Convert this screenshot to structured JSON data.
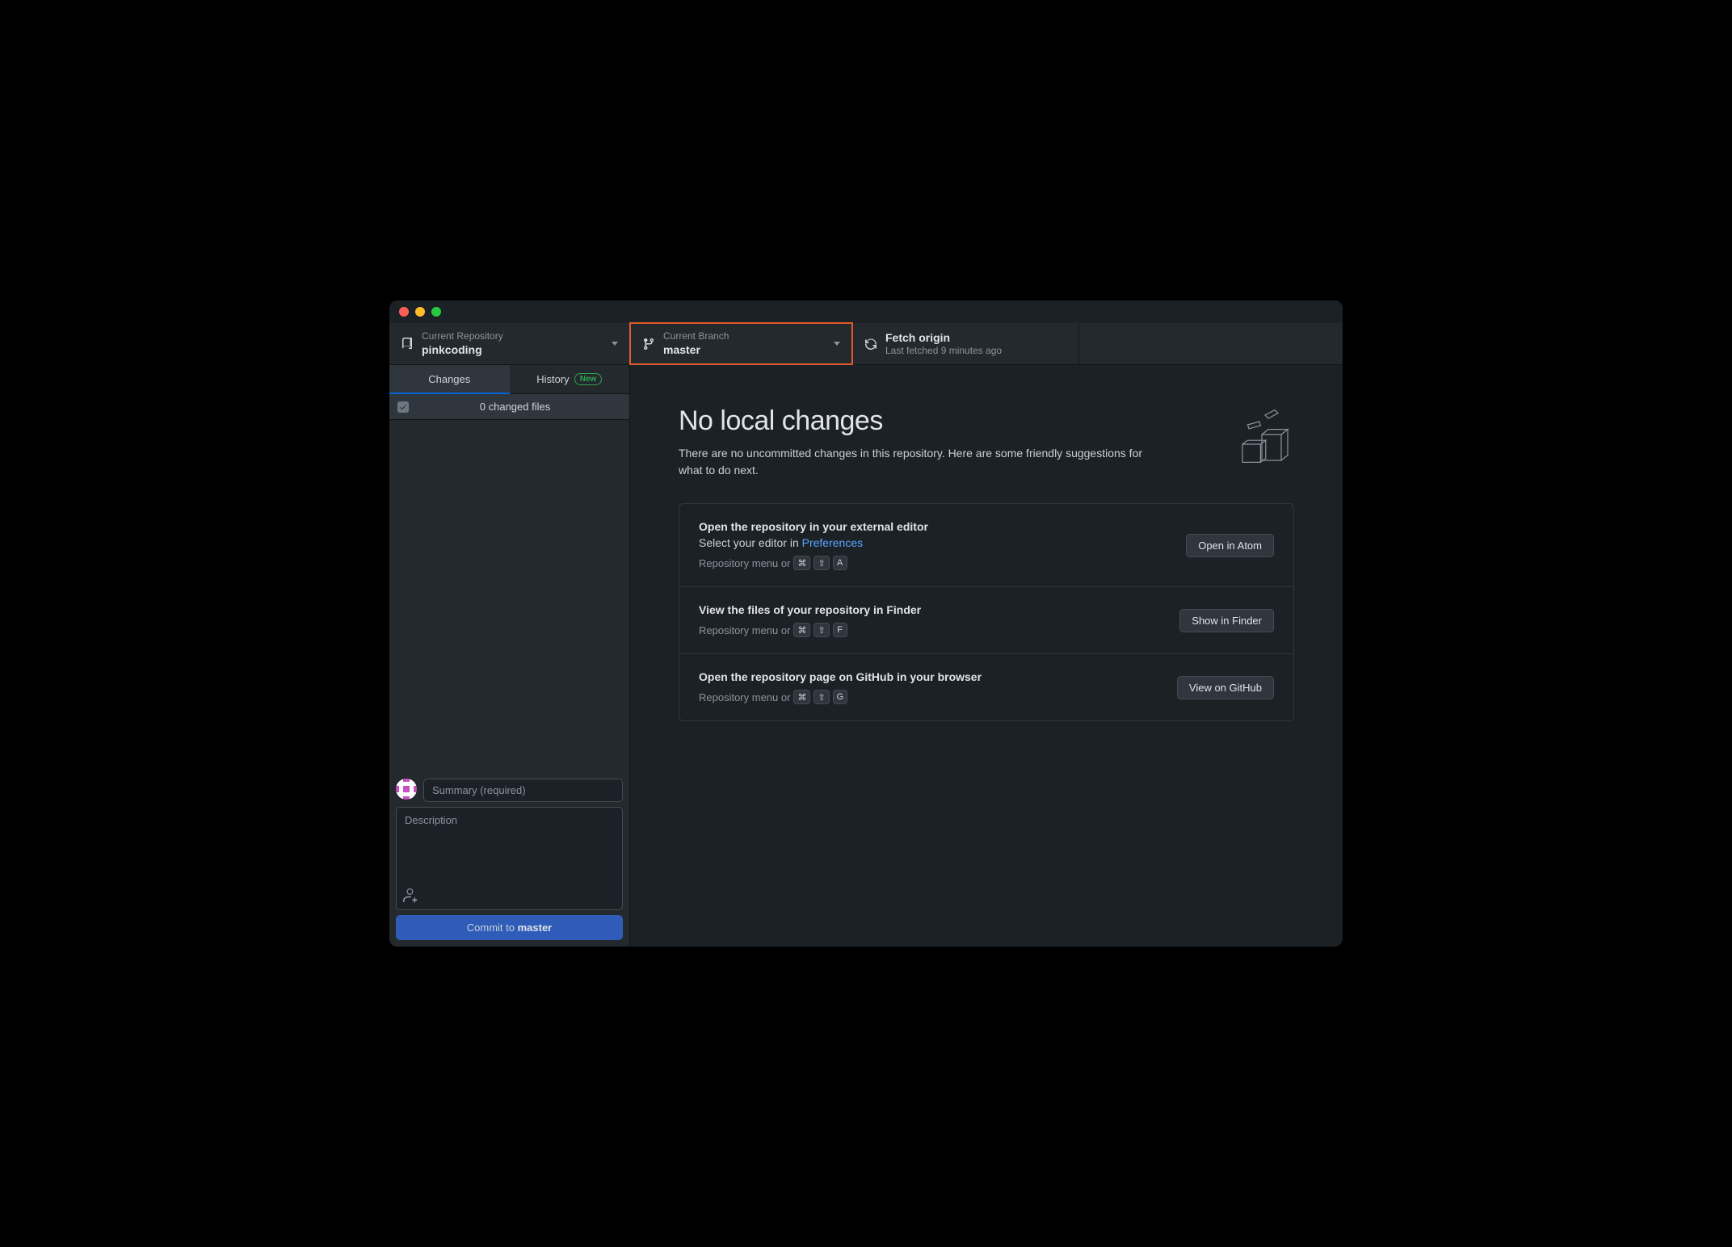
{
  "toolbar": {
    "repo": {
      "label": "Current Repository",
      "value": "pinkcoding"
    },
    "branch": {
      "label": "Current Branch",
      "value": "master"
    },
    "fetch": {
      "label": "Fetch origin",
      "sub": "Last fetched 9 minutes ago"
    }
  },
  "sidebar": {
    "tabs": {
      "changes": "Changes",
      "history": "History",
      "new_badge": "New"
    },
    "changes_count": "0 changed files",
    "summary_placeholder": "Summary (required)",
    "description_placeholder": "Description",
    "commit_prefix": "Commit to ",
    "commit_branch": "master"
  },
  "main": {
    "title": "No local changes",
    "subtitle": "There are no uncommitted changes in this repository. Here are some friendly suggestions for what to do next.",
    "suggestions": [
      {
        "title": "Open the repository in your external editor",
        "desc_prefix": "Select your editor in ",
        "desc_link": "Preferences",
        "hint_prefix": "Repository menu or",
        "keys": [
          "⌘",
          "⇧",
          "A"
        ],
        "button": "Open in Atom"
      },
      {
        "title": "View the files of your repository in Finder",
        "hint_prefix": "Repository menu or",
        "keys": [
          "⌘",
          "⇧",
          "F"
        ],
        "button": "Show in Finder"
      },
      {
        "title": "Open the repository page on GitHub in your browser",
        "hint_prefix": "Repository menu or",
        "keys": [
          "⌘",
          "⇧",
          "G"
        ],
        "button": "View on GitHub"
      }
    ]
  }
}
